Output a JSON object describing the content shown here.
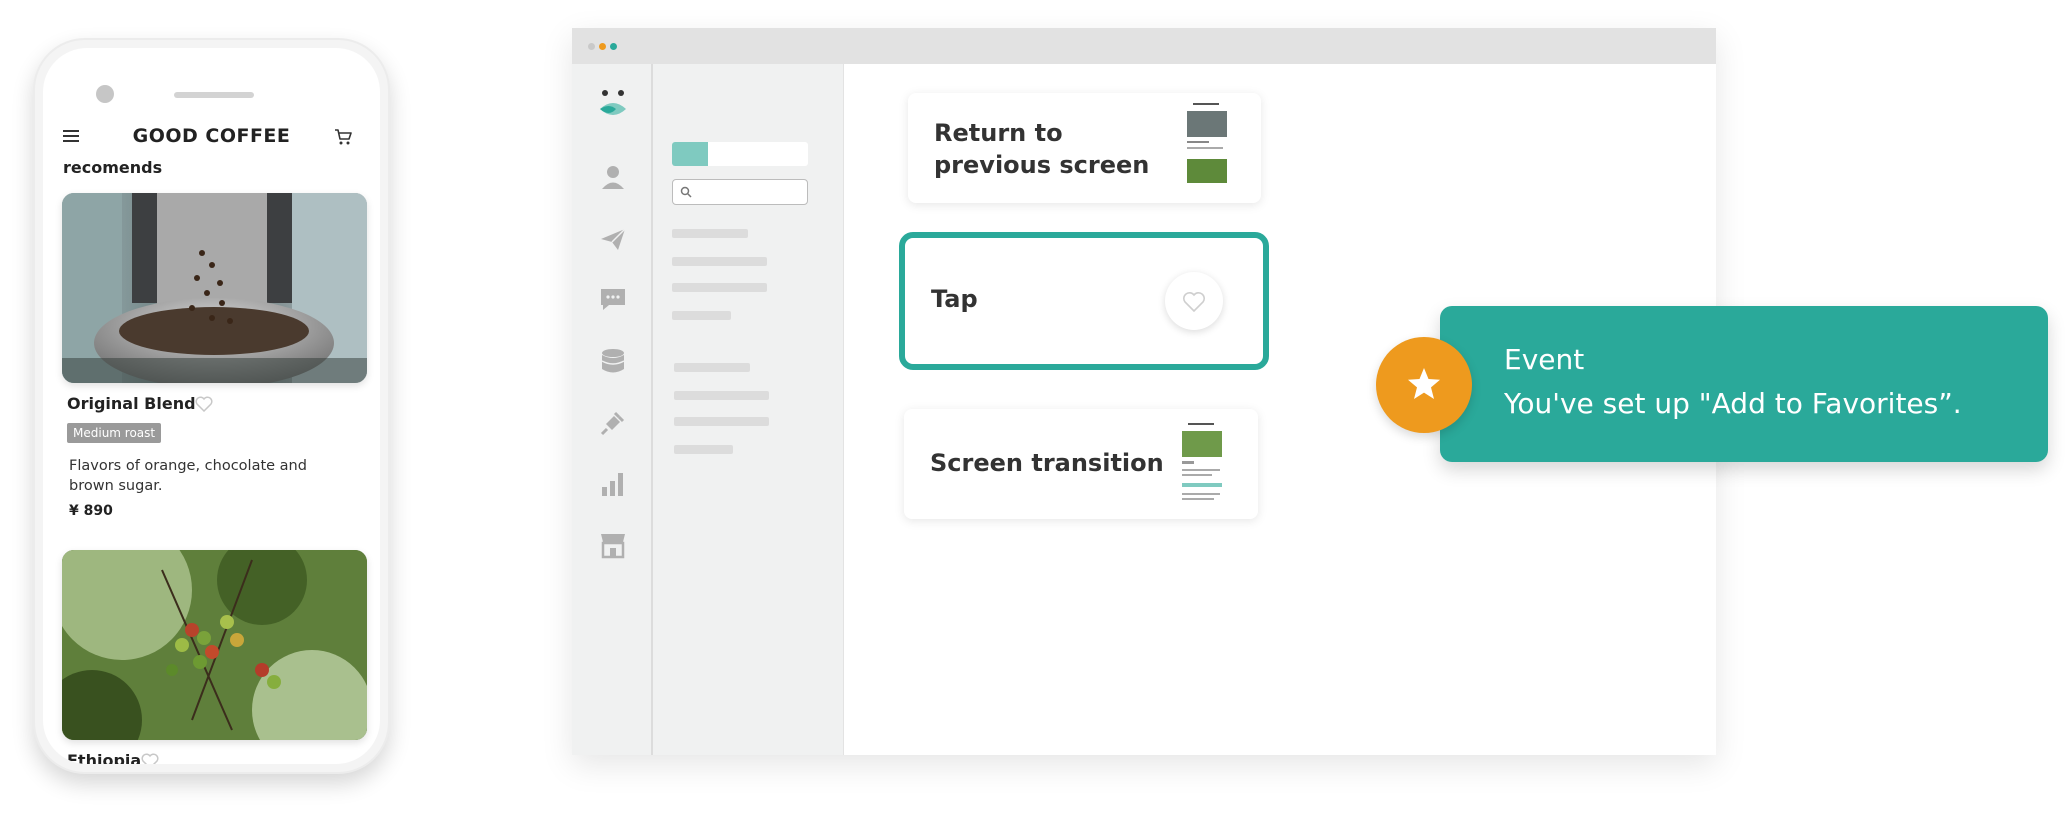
{
  "phone": {
    "app_title": "GOOD COFFEE",
    "section_title": "recomends",
    "products": [
      {
        "name": "Original Blend",
        "badge": "Medium roast",
        "description": "Flavors of orange, chocolate and brown sugar.",
        "price": "¥ 890"
      },
      {
        "name": "Ethiopia"
      }
    ],
    "icons": {
      "menu": "menu-icon",
      "cart": "cart-icon",
      "favorite": "heart-icon"
    }
  },
  "window": {
    "titlebar_dot_colors": [
      "#c9c9c9",
      "#ee9a1e",
      "#2aa99a"
    ],
    "rail_icons": [
      "logo-icon",
      "user-icon",
      "send-icon",
      "chat-icon",
      "database-icon",
      "plugin-icon",
      "chart-icon",
      "store-icon"
    ],
    "flow_cards": {
      "return": {
        "label_line1": "Return to",
        "label_line2": "previous screen"
      },
      "tap": {
        "label": "Tap"
      },
      "transition": {
        "label": "Screen transition"
      }
    }
  },
  "event": {
    "title": "Event",
    "text": "You've set up \"Add to Favorites”."
  },
  "colors": {
    "accent": "#2aa99a",
    "accent_light": "#7fcac0",
    "orange": "#ee9a1e"
  }
}
